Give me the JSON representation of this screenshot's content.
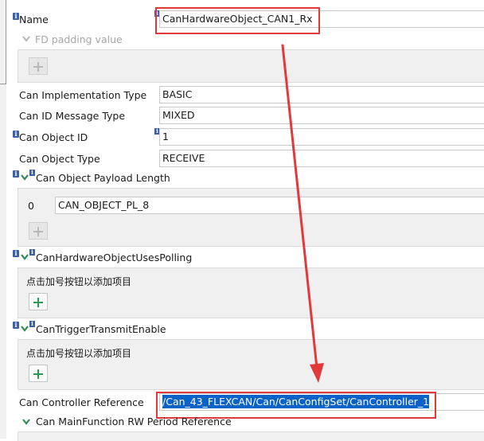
{
  "fields": {
    "name": {
      "label": "Name",
      "value": "CanHardwareObject_CAN1_Rx"
    },
    "fd_padding": {
      "label": "FD padding value"
    },
    "impl_type": {
      "label": "Can Implementation Type",
      "value": "BASIC"
    },
    "id_msg_type": {
      "label": "Can ID Message Type",
      "value": "MIXED"
    },
    "object_id": {
      "label": "Can Object ID",
      "value": "1"
    },
    "object_type": {
      "label": "Can Object Type",
      "value": "RECEIVE"
    },
    "payload": {
      "label": "Can Object Payload Length",
      "index": "0",
      "value": "CAN_OBJECT_PL_8"
    },
    "uses_polling": {
      "label": "CanHardwareObjectUsesPolling",
      "hint": "点击加号按钮以添加项目"
    },
    "trigger_tx": {
      "label": "CanTriggerTransmitEnable",
      "hint": "点击加号按钮以添加项目"
    },
    "controller_ref": {
      "label": "Can Controller Reference",
      "value": "/Can_43_FLEXCAN/Can/CanConfigSet/CanController_1"
    },
    "mainfunction_ref": {
      "label": "Can MainFunction RW Period Reference"
    }
  },
  "icons": {
    "info": "i",
    "plus": "plus-icon",
    "chevron": "chevron-down-icon",
    "arrow": "red-arrow"
  },
  "colors": {
    "annotation_red": "#e03a3a",
    "selection_blue": "#0a62c8",
    "add_green": "#2e9a4f"
  }
}
